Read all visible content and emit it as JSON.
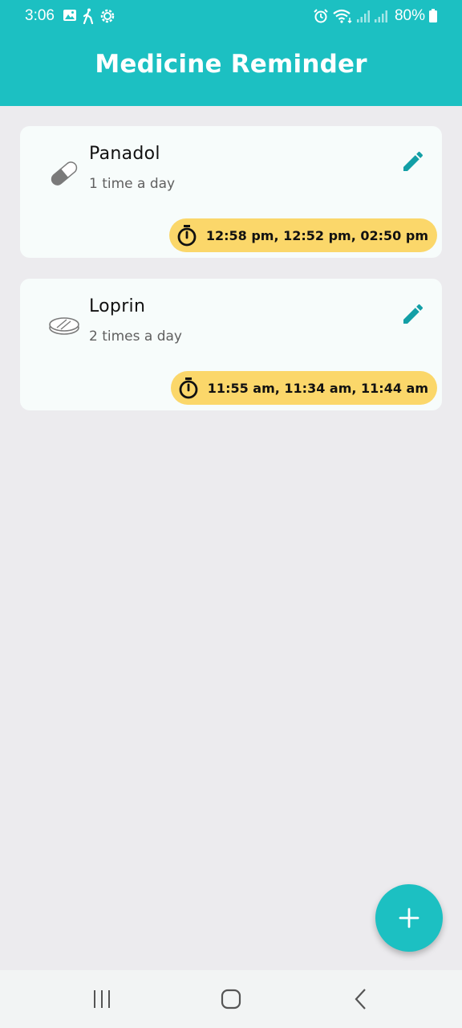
{
  "status_bar": {
    "time": "3:06",
    "left_icons": [
      "image-icon",
      "walking-icon",
      "gear-icon"
    ],
    "right_icons": [
      "alarm-icon",
      "wifi-icon",
      "signal-icon",
      "signal-icon-2"
    ],
    "battery": "80%"
  },
  "header": {
    "title": "Medicine Reminder"
  },
  "colors": {
    "accent": "#1cc0c2",
    "pill_bg": "#fbd76a",
    "edit": "#139fa6",
    "background": "#ecebee"
  },
  "medicines": [
    {
      "name": "Panadol",
      "frequency": "1 time a day",
      "times": "12:58 pm, 12:52 pm, 02:50 pm",
      "icon": "capsule-icon"
    },
    {
      "name": "Loprin",
      "frequency": "2 times a day",
      "times": "11:55 am, 11:34 am, 11:44 am",
      "icon": "tablet-icon"
    }
  ],
  "fab": {
    "icon": "plus-icon"
  },
  "navbar": {
    "icons": [
      "recent-apps-icon",
      "home-icon",
      "back-icon"
    ]
  }
}
